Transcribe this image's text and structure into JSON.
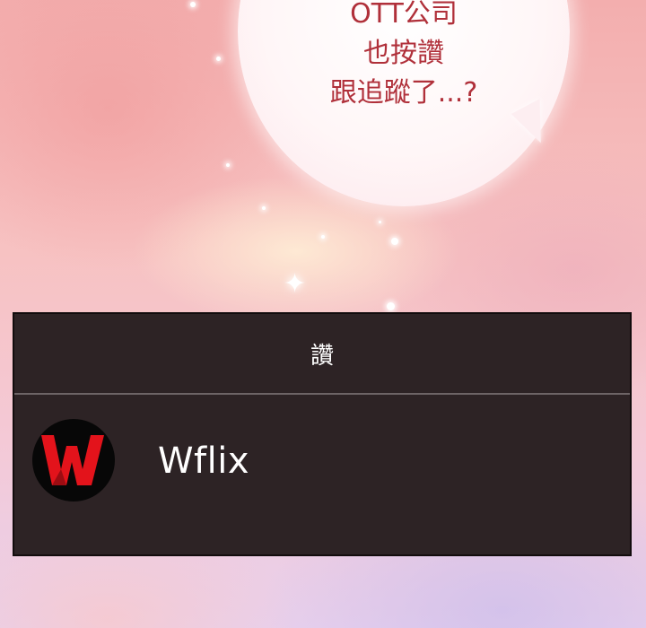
{
  "speech_bubble": {
    "lines": [
      "OTT公司",
      "也按讚",
      "跟追蹤了...?"
    ],
    "text_color": "#b0303a"
  },
  "dialog": {
    "title": "讚",
    "background_color": "#2d2325",
    "options": [
      {
        "label": "Wflix",
        "icon": "wflix-logo-icon",
        "icon_letter": "W",
        "icon_color": "#e3131b"
      }
    ]
  }
}
